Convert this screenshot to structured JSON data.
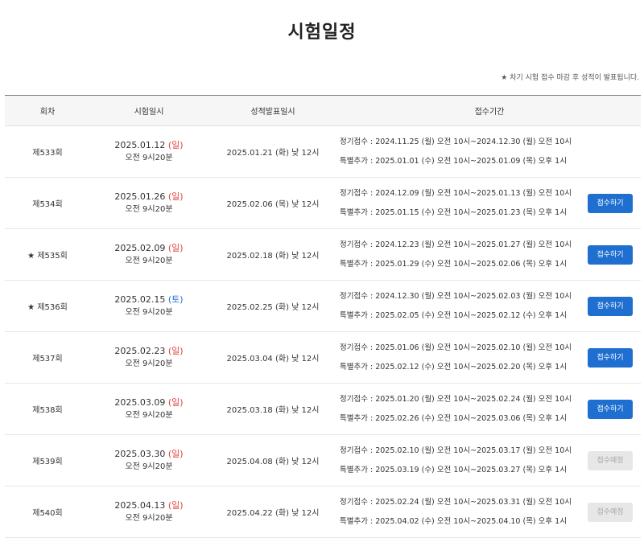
{
  "page": {
    "title": "시험일정",
    "notice": "★ 차기 시험 접수 마감 후 성적이 발표됩니다."
  },
  "table": {
    "headers": [
      "회차",
      "시험일시",
      "성적발표일시",
      "접수기간"
    ],
    "rows": [
      {
        "round": "제533회",
        "exam_date": "2025.01.12",
        "exam_day": "(일)",
        "day_type": "sun",
        "exam_time": "오전 9시20분",
        "result_date": "2025.01.21 (화) 낮 12시",
        "regular": "정기접수 : 2024.11.25 (월) 오전 10시~2024.12.30 (월) 오전 10시",
        "special": "특별추가 : 2025.01.01 (수) 오전 10시~2025.01.09 (목) 오후 1시",
        "button": ""
      },
      {
        "round": "제534회",
        "exam_date": "2025.01.26",
        "exam_day": "(일)",
        "day_type": "sun",
        "exam_time": "오전 9시20분",
        "result_date": "2025.02.06 (목) 낮 12시",
        "regular": "정기접수 : 2024.12.09 (월) 오전 10시~2025.01.13 (월) 오전 10시",
        "special": "특별추가 : 2025.01.15 (수) 오전 10시~2025.01.23 (목) 오후 1시",
        "button": "접수하기"
      },
      {
        "round": "★ 제535회",
        "exam_date": "2025.02.09",
        "exam_day": "(일)",
        "day_type": "sun",
        "exam_time": "오전 9시20분",
        "result_date": "2025.02.18 (화) 낮 12시",
        "regular": "정기접수 : 2024.12.23 (월) 오전 10시~2025.01.27 (월) 오전 10시",
        "special": "특별추가 : 2025.01.29 (수) 오전 10시~2025.02.06 (목) 오후 1시",
        "button": "접수하기"
      },
      {
        "round": "★ 제536회",
        "exam_date": "2025.02.15",
        "exam_day": "(토)",
        "day_type": "sat",
        "exam_time": "오전 9시20분",
        "result_date": "2025.02.25 (화) 낮 12시",
        "regular": "정기접수 : 2024.12.30 (월) 오전 10시~2025.02.03 (월) 오전 10시",
        "special": "특별추가 : 2025.02.05 (수) 오전 10시~2025.02.12 (수) 오후 1시",
        "button": "접수하기"
      },
      {
        "round": "제537회",
        "exam_date": "2025.02.23",
        "exam_day": "(일)",
        "day_type": "sun",
        "exam_time": "오전 9시20분",
        "result_date": "2025.03.04 (화) 낮 12시",
        "regular": "정기접수 : 2025.01.06 (월) 오전 10시~2025.02.10 (월) 오전 10시",
        "special": "특별추가 : 2025.02.12 (수) 오전 10시~2025.02.20 (목) 오후 1시",
        "button": "접수하기"
      },
      {
        "round": "제538회",
        "exam_date": "2025.03.09",
        "exam_day": "(일)",
        "day_type": "sun",
        "exam_time": "오전 9시20분",
        "result_date": "2025.03.18 (화) 낮 12시",
        "regular": "정기접수 : 2025.01.20 (월) 오전 10시~2025.02.24 (월) 오전 10시",
        "special": "특별추가 : 2025.02.26 (수) 오전 10시~2025.03.06 (목) 오후 1시",
        "button": "접수하기"
      },
      {
        "round": "제539회",
        "exam_date": "2025.03.30",
        "exam_day": "(일)",
        "day_type": "sun",
        "exam_time": "오전 9시20분",
        "result_date": "2025.04.08 (화) 낮 12시",
        "regular": "정기접수 : 2025.02.10 (월) 오전 10시~2025.03.17 (월) 오전 10시",
        "special": "특별추가 : 2025.03.19 (수) 오전 10시~2025.03.27 (목) 오후 1시",
        "button": "접수예정"
      },
      {
        "round": "제540회",
        "exam_date": "2025.04.13",
        "exam_day": "(일)",
        "day_type": "sun",
        "exam_time": "오전 9시20분",
        "result_date": "2025.04.22 (화) 낮 12시",
        "regular": "정기접수 : 2025.02.24 (월) 오전 10시~2025.03.31 (월) 오전 10시",
        "special": "특별추가 : 2025.04.02 (수) 오전 10시~2025.04.10 (목) 오후 1시",
        "button": "접수예정"
      }
    ]
  },
  "colors": {
    "button_active": "#1f6fd1",
    "button_disabled": "#e7e7e7",
    "sunday": "#e0413b",
    "saturday": "#2a6fd6"
  }
}
